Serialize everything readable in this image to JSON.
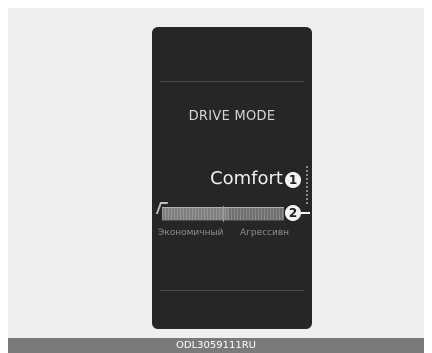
{
  "display": {
    "title": "DRIVE MODE",
    "mode_value": "Comfort",
    "gauge": {
      "left_label": "Экономичный",
      "right_label": "Агрессивн",
      "level": 0.55
    }
  },
  "callouts": [
    "1",
    "2"
  ],
  "caption": "ODL3059111RU",
  "colors": {
    "screen_bg": "#262626",
    "frame_bg": "#efefef",
    "caption_bar": "#7a7a7a"
  }
}
